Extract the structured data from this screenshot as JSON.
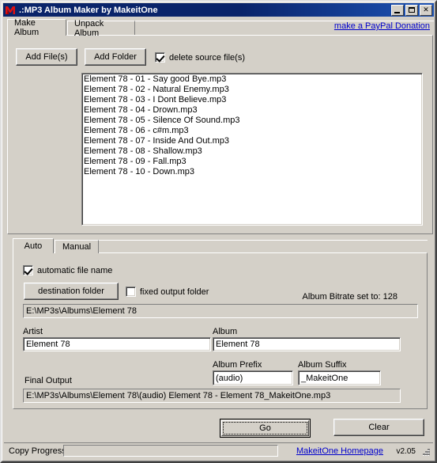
{
  "window": {
    "title": ".:MP3 Album Maker by MakeitOne",
    "icon": "app-logo-icon",
    "minimize_label": "Minimize",
    "maximize_label": "Maximize",
    "close_label": "✕"
  },
  "top_tabs": [
    {
      "label": "Make Album",
      "active": true
    },
    {
      "label": "Unpack Album",
      "active": false
    }
  ],
  "donation_link": "make a PayPal Donation",
  "make_album": {
    "add_files_label": "Add File(s)",
    "add_folder_label": "Add Folder",
    "delete_source_label": "delete source file(s)",
    "delete_source_checked": true,
    "files": [
      "Element 78 - 01 - Say good Bye.mp3",
      "Element 78 - 02 - Natural Enemy.mp3",
      "Element 78 - 03 - I Dont Believe.mp3",
      "Element 78 - 04 - Drown.mp3",
      "Element 78 - 05 - Silence Of Sound.mp3",
      "Element 78 - 06 - c#m.mp3",
      "Element 78 - 07 - Inside And Out.mp3",
      "Element 78 - 08 - Shallow.mp3",
      "Element 78 - 09 - Fall.mp3",
      "Element 78 - 10 - Down.mp3"
    ]
  },
  "sub_tabs": [
    {
      "label": "Auto",
      "active": true
    },
    {
      "label": "Manual",
      "active": false
    }
  ],
  "auto_panel": {
    "automatic_file_name_label": "automatic file name",
    "automatic_file_name_checked": true,
    "destination_folder_button": "destination folder",
    "fixed_output_folder_label": "fixed output folder",
    "fixed_output_folder_checked": false,
    "bitrate_label": "Album Bitrate set to: 128",
    "destination_path": "E:\\MP3s\\Albums\\Element 78",
    "artist_label": "Artist",
    "artist_value": "Element 78",
    "album_label": "Album",
    "album_value": "Element 78",
    "album_prefix_label": "Album Prefix",
    "album_prefix_value": "(audio)",
    "album_suffix_label": "Album Suffix",
    "album_suffix_value": "_MakeitOne",
    "final_output_label": "Final Output",
    "final_output_value": "E:\\MP3s\\Albums\\Element 78\\(audio) Element 78 - Element 78_MakeitOne.mp3"
  },
  "actions": {
    "go_label": "Go",
    "clear_label": "Clear"
  },
  "status": {
    "copy_progress_label": "Copy Progress",
    "copy_progress_percent": 0,
    "homepage_link": "MakeitOne Homepage",
    "version": "v2.05"
  },
  "colors": {
    "face": "#d4d0c8",
    "titlebar": "#0a246a",
    "link": "#0000cc",
    "field": "#ffffff"
  }
}
